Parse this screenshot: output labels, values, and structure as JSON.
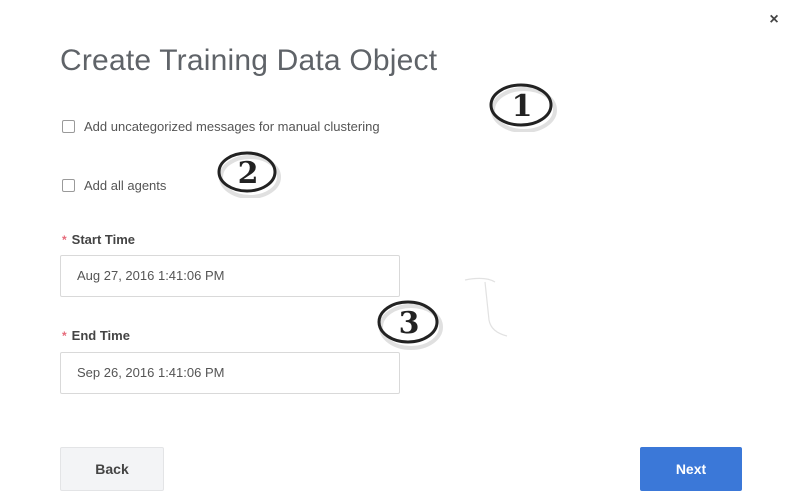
{
  "dialog": {
    "title": "Create Training Data Object",
    "close_glyph": "×"
  },
  "options": [
    {
      "label": "Add uncategorized messages for manual clustering",
      "checked": false
    },
    {
      "label": "Add all agents",
      "checked": false
    }
  ],
  "fields": {
    "start_time": {
      "label": "Start Time",
      "required_mark": "*",
      "value": "Aug 27, 2016 1:41:06 PM"
    },
    "end_time": {
      "label": "End Time",
      "required_mark": "*",
      "value": "Sep 26, 2016 1:41:06 PM"
    }
  },
  "buttons": {
    "back": "Back",
    "next": "Next"
  },
  "callouts": [
    "1",
    "2",
    "3"
  ],
  "colors": {
    "primary": "#3b78d8",
    "required": "#e66a7a",
    "title": "#5f6368"
  }
}
